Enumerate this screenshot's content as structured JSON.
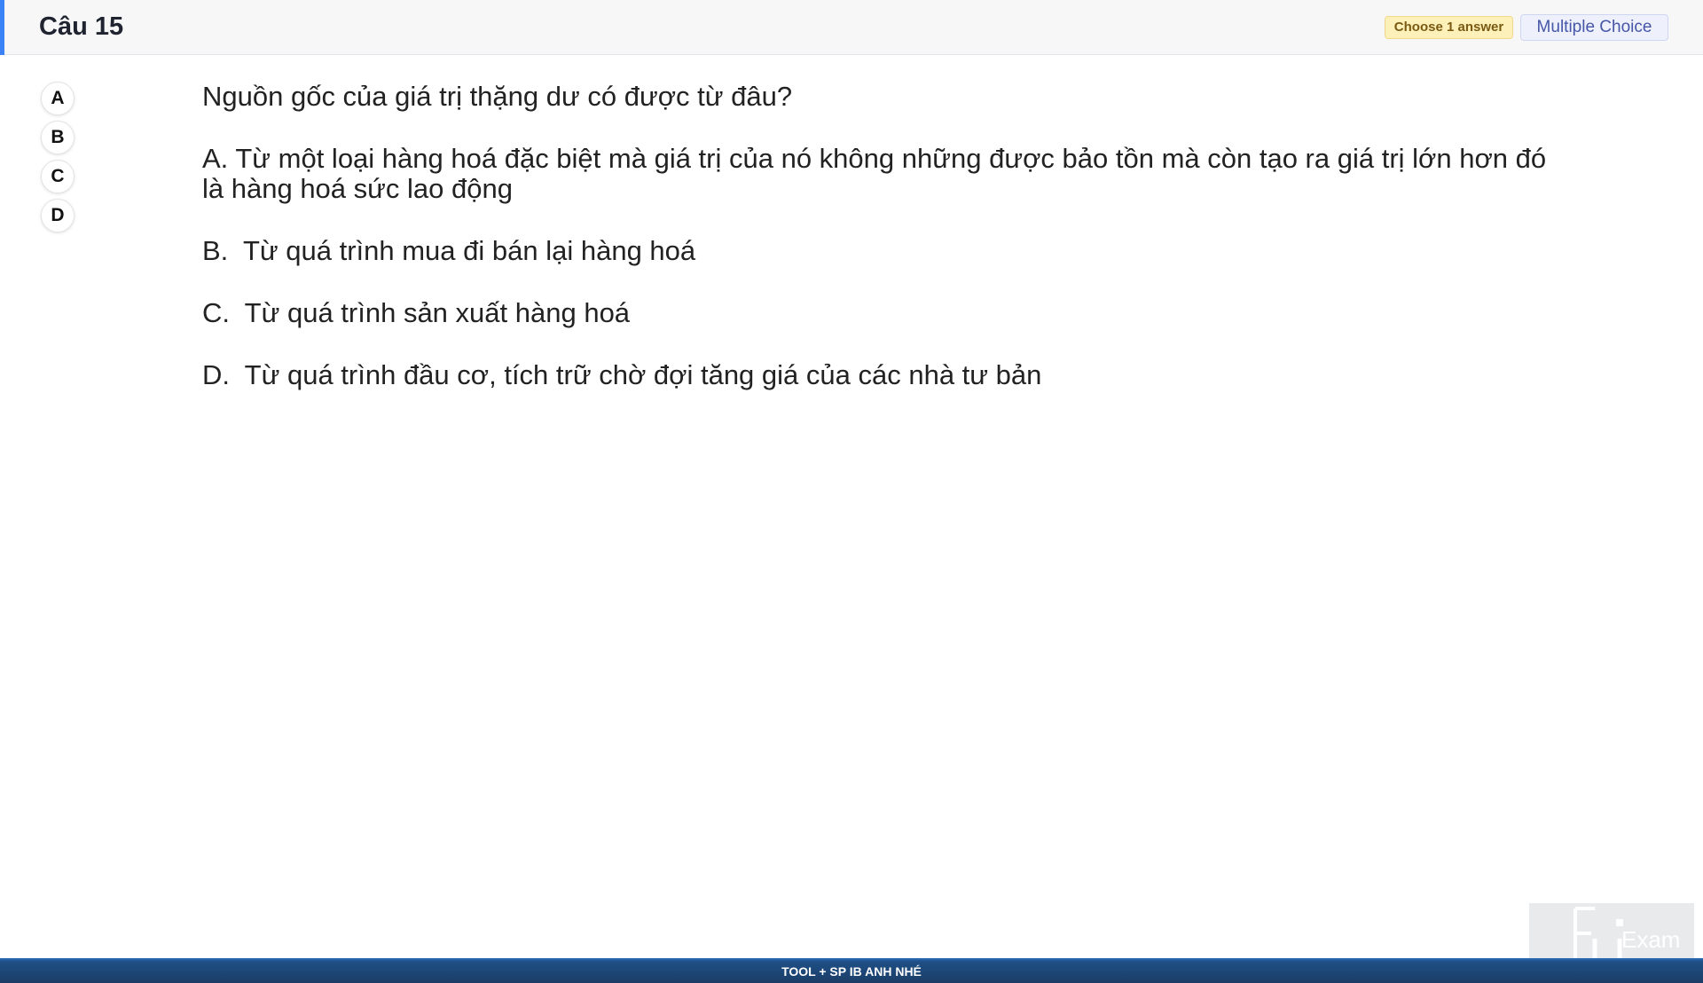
{
  "header": {
    "title": "Câu 15",
    "badge_choose": "Choose 1 answer",
    "badge_type": "Multiple Choice"
  },
  "options": [
    "A",
    "B",
    "C",
    "D"
  ],
  "question": {
    "text": "Nguồn gốc của giá trị thặng dư có được từ đâu?",
    "answers": [
      "A.  Từ một loại hàng hoá đặc biệt mà giá trị của nó không những được bảo tồn mà còn tạo ra giá trị lớn hơn đó là hàng hoá sức lao động",
      "B.  Từ quá trình mua đi bán lại hàng hoá",
      "C.  Từ quá trình sản xuất hàng hoá",
      "D.  Từ quá trình đầu cơ, tích trữ chờ đợi tăng giá của các nhà tư bản"
    ]
  },
  "footer": {
    "text": "TOOL + SP IB ANH NHÉ"
  },
  "logo": {
    "text": "Exam"
  }
}
